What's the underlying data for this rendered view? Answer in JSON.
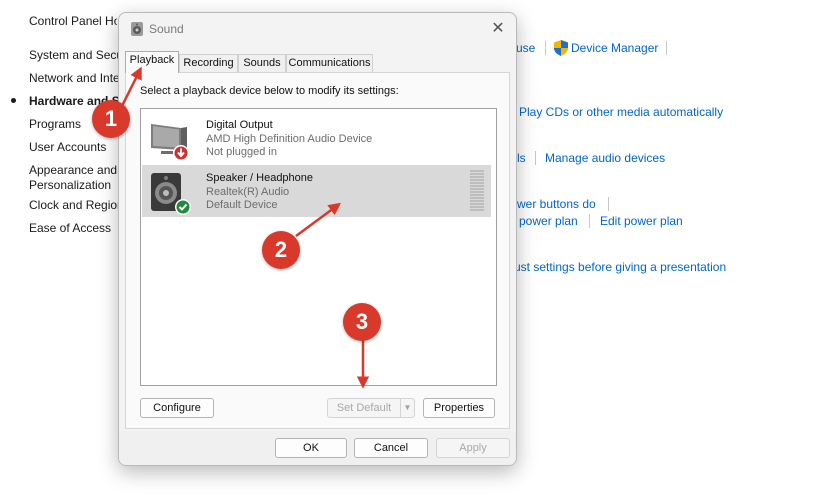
{
  "control_panel": {
    "nav": [
      {
        "label": "Control Panel Home",
        "active": false
      },
      {
        "label": "System and Security",
        "active": false
      },
      {
        "label": "Network and Internet",
        "active": false
      },
      {
        "label": "Hardware and Sound",
        "active": true
      },
      {
        "label": "Programs",
        "active": false
      },
      {
        "label": "User Accounts",
        "active": false
      },
      {
        "label": "Appearance and",
        "active": false
      },
      {
        "label": "Personalization",
        "active": false
      },
      {
        "label": "Clock and Region",
        "active": false
      },
      {
        "label": "Ease of Access",
        "active": false
      }
    ],
    "links": {
      "mouse": "use",
      "device_manager": "Device Manager",
      "autoplay": "Play CDs or other media automatically",
      "sounds": "ls",
      "manage_audio": "Manage audio devices",
      "power_buttons": "wer buttons do",
      "power_plan": "power plan",
      "edit_power_plan": "Edit power plan",
      "presentation": "ust settings before giving a presentation"
    }
  },
  "dialog": {
    "title": "Sound",
    "close_icon": "close-icon",
    "tabs": [
      "Playback",
      "Recording",
      "Sounds",
      "Communications"
    ],
    "active_tab": "Playback",
    "instruction": "Select a playback device below to modify its settings:",
    "devices": [
      {
        "name": "Digital Output",
        "driver": "AMD High Definition Audio Device",
        "status": "Not plugged in",
        "badge": "unplugged-arrow-icon",
        "selected": false
      },
      {
        "name": "Speaker / Headphone",
        "driver": "Realtek(R) Audio",
        "status": "Default Device",
        "badge": "default-check-icon",
        "selected": true
      }
    ],
    "buttons": {
      "configure": "Configure",
      "set_default": "Set Default",
      "properties": "Properties",
      "ok": "OK",
      "cancel": "Cancel",
      "apply": "Apply"
    }
  },
  "annotations": [
    "1",
    "2",
    "3"
  ],
  "colors": {
    "link": "#0066cc",
    "marker": "#d8392b",
    "selected_row": "#d9d9d9",
    "check_badge": "#1e8a3a",
    "unplugged_badge": "#d32f2f"
  }
}
